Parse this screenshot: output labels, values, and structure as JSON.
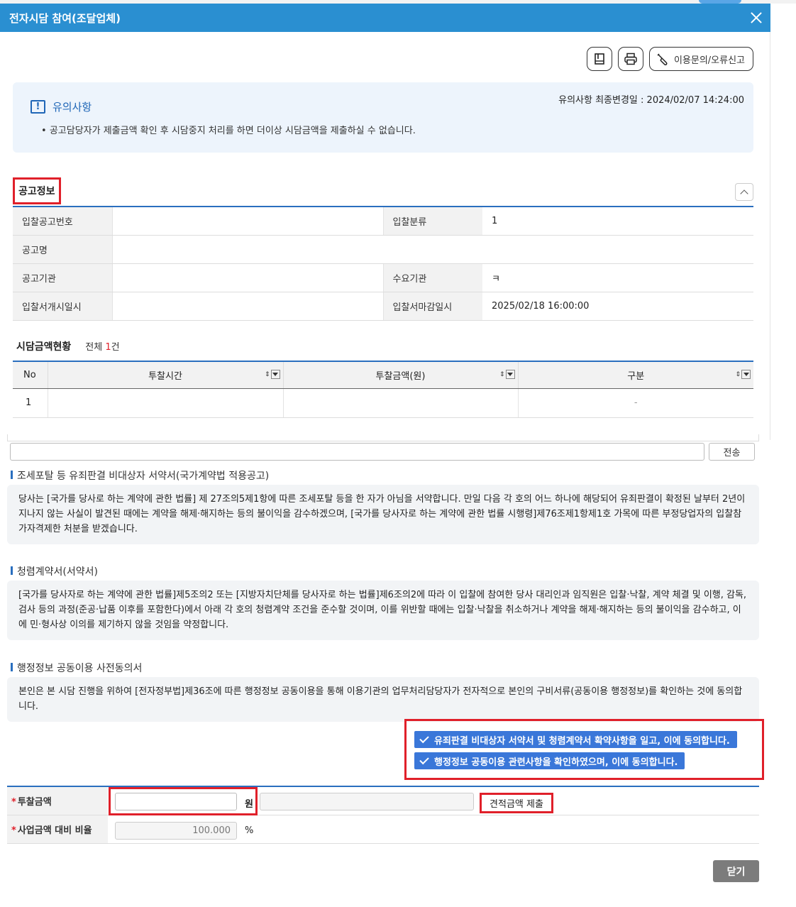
{
  "window": {
    "title": "전자시담 참여(조달업체)"
  },
  "toolbar": {
    "help_label": "이용문의/오류신고"
  },
  "notice": {
    "title": "유의사항",
    "updated": "유의사항 최종변경일 : 2024/02/07 14:24:00",
    "item": "공고담당자가 제출금액 확인 후 시담중지 처리를 하면 더이상 시담금액을 제출하실 수 없습니다."
  },
  "info": {
    "title": "공고정보",
    "rows": [
      {
        "label": "입찰공고번호",
        "value": "",
        "label2": "입찰분류",
        "value2": "1"
      },
      {
        "label": "공고명",
        "value": ""
      },
      {
        "label": "공고기관",
        "value": "",
        "label2": "수요기관",
        "value2": "ㅋ"
      },
      {
        "label": "입찰서개시일시",
        "value": "",
        "label2": "입찰서마감일시",
        "value2": "2025/02/18 16:00:00"
      }
    ]
  },
  "bids": {
    "title": "시담금액현황",
    "count_prefix": "전체 ",
    "count": "1",
    "count_suffix": "건",
    "columns": [
      "No",
      "투찰시간",
      "투찰금액(원)",
      "구분"
    ],
    "rows": [
      {
        "no": "1",
        "time": "",
        "amount": "",
        "type": "-"
      }
    ]
  },
  "send": {
    "label": "전송"
  },
  "pledges": [
    {
      "title": "조세포탈 등 유죄판결 비대상자 서약서(국가계약법 적용공고)",
      "body": "당사는 [국가를 당사로 하는 계약에 관한 법률] 제 27조의5제1항에 따른 조세포탈 등을 한 자가 아님을 서약합니다. 만일 다음 각 호의 어느 하나에 해당되어 유죄판결이 확정된 날부터 2년이 지나지 않는 사실이 발견된 때에는 계약을 해제·해지하는 등의 불이익을 감수하겠으며, [국가를 당사자로 하는 계약에 관한 법률 시행령]제76조제1항제1호 가목에 따른 부정당업자의 입찰참가자격제한 처분을 받겠습니다."
    },
    {
      "title": "청렴계약서(서약서)",
      "body": "[국가를 당사자로 하는 계약에 관한 법률]제5조의2 또는 [지방자치단체를 당사자로 하는 법률]제6조의2에 따라 이 입찰에 참여한 당사 대리인과 임직원은 입찰·낙찰, 계약 체결 및 이행, 감독, 검사 등의 과정(준공·납품 이후를 포함한다)에서 아래 각 호의 청렴계약 조건을 준수할 것이며, 이를 위반할 때에는 입찰·낙찰을 취소하거나 계약을 해제·해지하는 등의 불이익을 감수하고, 이에 민·형사상 이의를 제기하지 않을 것임을 약정합니다."
    },
    {
      "title": "행정정보 공동이용 사전동의서",
      "body": "본인은 본 시담 진행을 위하여 [전자정부법]제36조에 따른 행정정보 공동이용을 통해 이용기관의 업무처리담당자가 전자적으로 본인의 구비서류(공동이용 행정정보)를 확인하는 것에 동의합니다."
    }
  ],
  "agree": {
    "pledge_label": "유죄판결 비대상자 서약서 및 청렴계약서 확약사항을 일고, 이에 동의합니다.",
    "admin_label": "행정정보 공동이용 관련사항을 확인하였으며, 이에 동의합니다."
  },
  "form": {
    "required_mark": "*",
    "bid_amount_label": "투찰금액",
    "won": "원",
    "quote_button": "견적금액 제출",
    "ratio_label": "사업금액 대비 비율",
    "ratio_value": "100.000",
    "percent": "%"
  },
  "footer": {
    "close_label": "닫기"
  },
  "colors": {
    "title_bar": "#2a8fd1",
    "accent": "#2a6fbf",
    "highlight": "#e0202a",
    "agree_button": "#3a77d9"
  }
}
